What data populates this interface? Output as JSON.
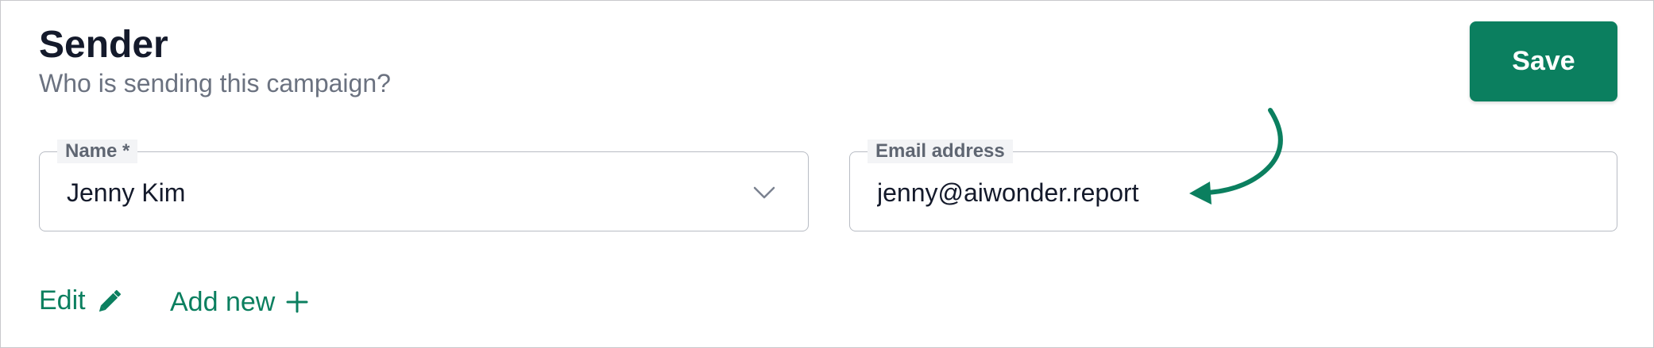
{
  "section": {
    "title": "Sender",
    "subtitle": "Who is sending this campaign?"
  },
  "toolbar": {
    "save_label": "Save"
  },
  "fields": {
    "name": {
      "label": "Name *",
      "value": "Jenny Kim"
    },
    "email": {
      "label": "Email address",
      "value": "jenny@aiwonder.report"
    }
  },
  "actions": {
    "edit_label": "Edit",
    "add_new_label": "Add new"
  },
  "icons": {
    "edit": "pencil-icon",
    "add": "plus-icon",
    "dropdown": "chevron-down-icon",
    "annotation": "curved-arrow-icon"
  },
  "colors": {
    "accent": "#0b7f5f",
    "title_text": "#141a2b",
    "muted_text": "#6b7280",
    "border": "#b8bcc4"
  }
}
